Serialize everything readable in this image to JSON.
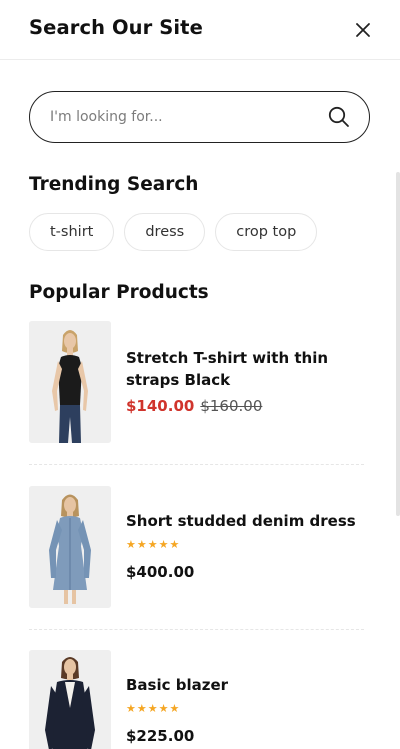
{
  "header": {
    "title": "Search Our Site",
    "close_icon": "close-icon"
  },
  "search": {
    "placeholder": "I'm looking for...",
    "value": "",
    "icon": "search-icon"
  },
  "trending": {
    "title": "Trending Search",
    "tags": [
      "t-shirt",
      "dress",
      "crop top"
    ]
  },
  "popular": {
    "title": "Popular Products",
    "products": [
      {
        "name_line1": "Stretch T-shirt with thin",
        "name_line2": "straps Black",
        "sale_price": "$140.00",
        "old_price": "$160.00",
        "rating": 0
      },
      {
        "name": "Short studded denim dress",
        "price": "$400.00",
        "rating": 5
      },
      {
        "name": "Basic blazer",
        "price": "$225.00",
        "rating": 5
      }
    ]
  },
  "colors": {
    "sale": "#d0342c",
    "star": "#f5a623",
    "text": "#111111"
  }
}
